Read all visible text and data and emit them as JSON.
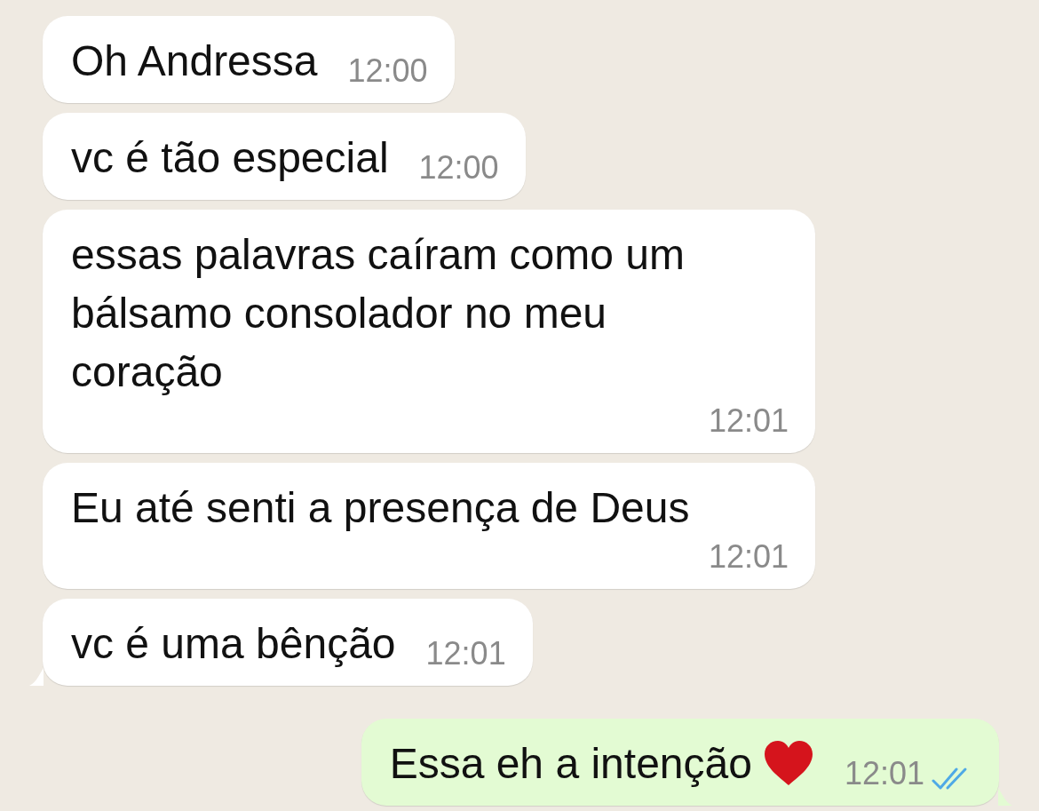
{
  "messages": [
    {
      "kind": "received",
      "text": "Oh Andressa",
      "time": "12:00",
      "tail": false
    },
    {
      "kind": "received",
      "text": "vc é tão especial",
      "time": "12:00",
      "tail": false
    },
    {
      "kind": "received",
      "text": "essas palavras caíram como  um bálsamo consolador no meu coração",
      "time": "12:01",
      "tail": false
    },
    {
      "kind": "received",
      "text": "Eu até senti a presença de Deus",
      "time": "12:01",
      "tail": false
    },
    {
      "kind": "received",
      "text": "vc é uma bênção",
      "time": "12:01",
      "tail": true
    },
    {
      "kind": "sent",
      "text": "Essa eh a intenção",
      "heart": true,
      "time": "12:01",
      "tail": true,
      "read": true
    }
  ]
}
